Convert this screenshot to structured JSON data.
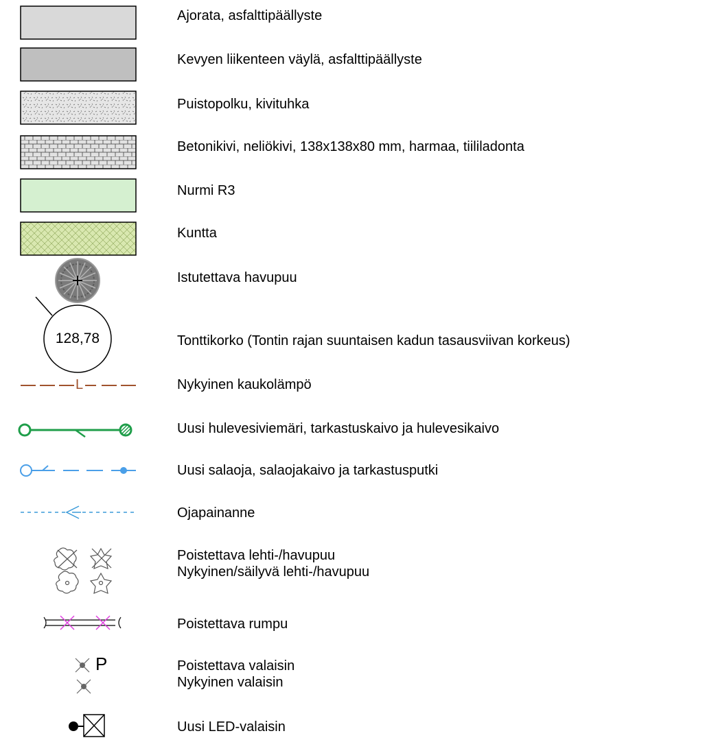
{
  "legend": {
    "items": [
      {
        "id": "asphalt-road",
        "label": "Ajorata, asfalttipäällyste",
        "swatch_color": "#d9d9d9"
      },
      {
        "id": "light-traffic-path",
        "label": "Kevyen liikenteen väylä, asfalttipäällyste",
        "swatch_color": "#bfbfbf"
      },
      {
        "id": "park-path",
        "label": "Puistopolku, kivituhka",
        "swatch_color": "#e6e6e6"
      },
      {
        "id": "concrete-paver",
        "label": "Betonikivi, neliökivi, 138x138x80 mm, harmaa, tiililadonta",
        "swatch_color": "#e2e2e2"
      },
      {
        "id": "lawn",
        "label": "Nurmi R3",
        "swatch_color": "#d5f0d0"
      },
      {
        "id": "meadow",
        "label": "Kuntta",
        "swatch_color": "#d9e8b0"
      },
      {
        "id": "planted-conifer",
        "label": "Istutettava havupuu",
        "icon": "conifer-symbol"
      },
      {
        "id": "plot-elevation",
        "label": "Tonttikorko (Tontin rajan suuntaisen kadun tasausviivan korkeus)",
        "value": "128,78"
      },
      {
        "id": "district-heating",
        "label": "Nykyinen kaukolämpö",
        "line_letter": "L",
        "color": "#a0522d"
      },
      {
        "id": "storm-sewer",
        "label": "Uusi hulevesiviemäri, tarkastuskaivo ja hulevesikaivo",
        "color": "#1f9e4a"
      },
      {
        "id": "drain",
        "label": "Uusi salaoja, salaojakaivo ja tarkastusputki",
        "color": "#4a9fe8"
      },
      {
        "id": "ditch",
        "label": "Ojapainanne",
        "color": "#3a9ad9"
      },
      {
        "id": "trees",
        "label_1": "Poistettava lehti-/havupuu",
        "label_2": "Nykyinen/säilyvä lehti-/havupuu",
        "color": "#555555"
      },
      {
        "id": "culvert",
        "label": "Poistettava rumpu",
        "color": "#e040e0"
      },
      {
        "id": "lamps",
        "label_1": "Poistettava valaisin",
        "label_2": "Nykyinen valaisin",
        "marker_letter": "P"
      },
      {
        "id": "led-lamp",
        "label": "Uusi LED-valaisin"
      }
    ]
  }
}
